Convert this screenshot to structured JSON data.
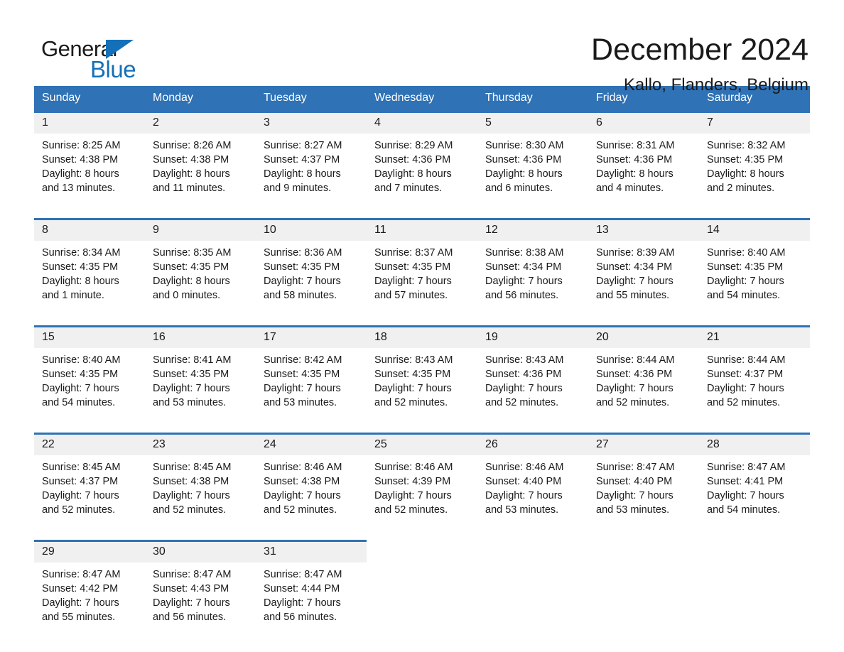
{
  "logo": {
    "word_one": "General",
    "word_two": "Blue",
    "triangle_color": "#1470b8"
  },
  "header": {
    "title": "December 2024",
    "subtitle": "Kallo, Flanders, Belgium"
  },
  "theme": {
    "header_blue": "#2f72b5",
    "daynum_background": "#f0f0f0",
    "page_background": "#ffffff",
    "text_color": "#1a1a1a"
  },
  "calendar": {
    "weekday_headers": [
      "Sunday",
      "Monday",
      "Tuesday",
      "Wednesday",
      "Thursday",
      "Friday",
      "Saturday"
    ],
    "labels": {
      "sunrise_prefix": "Sunrise:",
      "sunset_prefix": "Sunset:",
      "daylight_prefix": "Daylight:"
    },
    "weeks": [
      {
        "days": [
          {
            "day": "1",
            "sunrise": "Sunrise: 8:25 AM",
            "sunset": "Sunset: 4:38 PM",
            "daylight_line1": "Daylight: 8 hours",
            "daylight_line2": "and 13 minutes."
          },
          {
            "day": "2",
            "sunrise": "Sunrise: 8:26 AM",
            "sunset": "Sunset: 4:38 PM",
            "daylight_line1": "Daylight: 8 hours",
            "daylight_line2": "and 11 minutes."
          },
          {
            "day": "3",
            "sunrise": "Sunrise: 8:27 AM",
            "sunset": "Sunset: 4:37 PM",
            "daylight_line1": "Daylight: 8 hours",
            "daylight_line2": "and 9 minutes."
          },
          {
            "day": "4",
            "sunrise": "Sunrise: 8:29 AM",
            "sunset": "Sunset: 4:36 PM",
            "daylight_line1": "Daylight: 8 hours",
            "daylight_line2": "and 7 minutes."
          },
          {
            "day": "5",
            "sunrise": "Sunrise: 8:30 AM",
            "sunset": "Sunset: 4:36 PM",
            "daylight_line1": "Daylight: 8 hours",
            "daylight_line2": "and 6 minutes."
          },
          {
            "day": "6",
            "sunrise": "Sunrise: 8:31 AM",
            "sunset": "Sunset: 4:36 PM",
            "daylight_line1": "Daylight: 8 hours",
            "daylight_line2": "and 4 minutes."
          },
          {
            "day": "7",
            "sunrise": "Sunrise: 8:32 AM",
            "sunset": "Sunset: 4:35 PM",
            "daylight_line1": "Daylight: 8 hours",
            "daylight_line2": "and 2 minutes."
          }
        ]
      },
      {
        "days": [
          {
            "day": "8",
            "sunrise": "Sunrise: 8:34 AM",
            "sunset": "Sunset: 4:35 PM",
            "daylight_line1": "Daylight: 8 hours",
            "daylight_line2": "and 1 minute."
          },
          {
            "day": "9",
            "sunrise": "Sunrise: 8:35 AM",
            "sunset": "Sunset: 4:35 PM",
            "daylight_line1": "Daylight: 8 hours",
            "daylight_line2": "and 0 minutes."
          },
          {
            "day": "10",
            "sunrise": "Sunrise: 8:36 AM",
            "sunset": "Sunset: 4:35 PM",
            "daylight_line1": "Daylight: 7 hours",
            "daylight_line2": "and 58 minutes."
          },
          {
            "day": "11",
            "sunrise": "Sunrise: 8:37 AM",
            "sunset": "Sunset: 4:35 PM",
            "daylight_line1": "Daylight: 7 hours",
            "daylight_line2": "and 57 minutes."
          },
          {
            "day": "12",
            "sunrise": "Sunrise: 8:38 AM",
            "sunset": "Sunset: 4:34 PM",
            "daylight_line1": "Daylight: 7 hours",
            "daylight_line2": "and 56 minutes."
          },
          {
            "day": "13",
            "sunrise": "Sunrise: 8:39 AM",
            "sunset": "Sunset: 4:34 PM",
            "daylight_line1": "Daylight: 7 hours",
            "daylight_line2": "and 55 minutes."
          },
          {
            "day": "14",
            "sunrise": "Sunrise: 8:40 AM",
            "sunset": "Sunset: 4:35 PM",
            "daylight_line1": "Daylight: 7 hours",
            "daylight_line2": "and 54 minutes."
          }
        ]
      },
      {
        "days": [
          {
            "day": "15",
            "sunrise": "Sunrise: 8:40 AM",
            "sunset": "Sunset: 4:35 PM",
            "daylight_line1": "Daylight: 7 hours",
            "daylight_line2": "and 54 minutes."
          },
          {
            "day": "16",
            "sunrise": "Sunrise: 8:41 AM",
            "sunset": "Sunset: 4:35 PM",
            "daylight_line1": "Daylight: 7 hours",
            "daylight_line2": "and 53 minutes."
          },
          {
            "day": "17",
            "sunrise": "Sunrise: 8:42 AM",
            "sunset": "Sunset: 4:35 PM",
            "daylight_line1": "Daylight: 7 hours",
            "daylight_line2": "and 53 minutes."
          },
          {
            "day": "18",
            "sunrise": "Sunrise: 8:43 AM",
            "sunset": "Sunset: 4:35 PM",
            "daylight_line1": "Daylight: 7 hours",
            "daylight_line2": "and 52 minutes."
          },
          {
            "day": "19",
            "sunrise": "Sunrise: 8:43 AM",
            "sunset": "Sunset: 4:36 PM",
            "daylight_line1": "Daylight: 7 hours",
            "daylight_line2": "and 52 minutes."
          },
          {
            "day": "20",
            "sunrise": "Sunrise: 8:44 AM",
            "sunset": "Sunset: 4:36 PM",
            "daylight_line1": "Daylight: 7 hours",
            "daylight_line2": "and 52 minutes."
          },
          {
            "day": "21",
            "sunrise": "Sunrise: 8:44 AM",
            "sunset": "Sunset: 4:37 PM",
            "daylight_line1": "Daylight: 7 hours",
            "daylight_line2": "and 52 minutes."
          }
        ]
      },
      {
        "days": [
          {
            "day": "22",
            "sunrise": "Sunrise: 8:45 AM",
            "sunset": "Sunset: 4:37 PM",
            "daylight_line1": "Daylight: 7 hours",
            "daylight_line2": "and 52 minutes."
          },
          {
            "day": "23",
            "sunrise": "Sunrise: 8:45 AM",
            "sunset": "Sunset: 4:38 PM",
            "daylight_line1": "Daylight: 7 hours",
            "daylight_line2": "and 52 minutes."
          },
          {
            "day": "24",
            "sunrise": "Sunrise: 8:46 AM",
            "sunset": "Sunset: 4:38 PM",
            "daylight_line1": "Daylight: 7 hours",
            "daylight_line2": "and 52 minutes."
          },
          {
            "day": "25",
            "sunrise": "Sunrise: 8:46 AM",
            "sunset": "Sunset: 4:39 PM",
            "daylight_line1": "Daylight: 7 hours",
            "daylight_line2": "and 52 minutes."
          },
          {
            "day": "26",
            "sunrise": "Sunrise: 8:46 AM",
            "sunset": "Sunset: 4:40 PM",
            "daylight_line1": "Daylight: 7 hours",
            "daylight_line2": "and 53 minutes."
          },
          {
            "day": "27",
            "sunrise": "Sunrise: 8:47 AM",
            "sunset": "Sunset: 4:40 PM",
            "daylight_line1": "Daylight: 7 hours",
            "daylight_line2": "and 53 minutes."
          },
          {
            "day": "28",
            "sunrise": "Sunrise: 8:47 AM",
            "sunset": "Sunset: 4:41 PM",
            "daylight_line1": "Daylight: 7 hours",
            "daylight_line2": "and 54 minutes."
          }
        ]
      },
      {
        "days": [
          {
            "day": "29",
            "sunrise": "Sunrise: 8:47 AM",
            "sunset": "Sunset: 4:42 PM",
            "daylight_line1": "Daylight: 7 hours",
            "daylight_line2": "and 55 minutes."
          },
          {
            "day": "30",
            "sunrise": "Sunrise: 8:47 AM",
            "sunset": "Sunset: 4:43 PM",
            "daylight_line1": "Daylight: 7 hours",
            "daylight_line2": "and 56 minutes."
          },
          {
            "day": "31",
            "sunrise": "Sunrise: 8:47 AM",
            "sunset": "Sunset: 4:44 PM",
            "daylight_line1": "Daylight: 7 hours",
            "daylight_line2": "and 56 minutes."
          },
          {
            "day": "",
            "sunrise": "",
            "sunset": "",
            "daylight_line1": "",
            "daylight_line2": ""
          },
          {
            "day": "",
            "sunrise": "",
            "sunset": "",
            "daylight_line1": "",
            "daylight_line2": ""
          },
          {
            "day": "",
            "sunrise": "",
            "sunset": "",
            "daylight_line1": "",
            "daylight_line2": ""
          },
          {
            "day": "",
            "sunrise": "",
            "sunset": "",
            "daylight_line1": "",
            "daylight_line2": ""
          }
        ]
      }
    ]
  }
}
